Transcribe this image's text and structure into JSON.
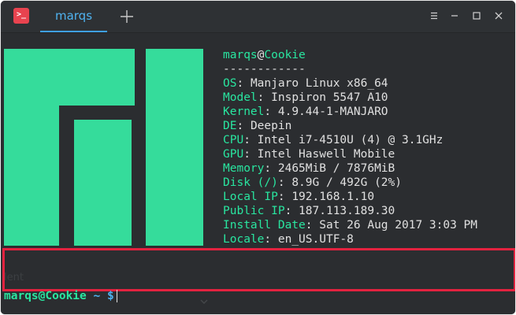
{
  "titlebar": {
    "app_icon_glyph": ">_",
    "tab_label": "marqs"
  },
  "sysinfo": {
    "user": "marqs",
    "at": "@",
    "host": "Cookie",
    "separator": "------------",
    "fields": [
      {
        "key": "OS",
        "value": "Manjaro Linux x86_64"
      },
      {
        "key": "Model",
        "value": "Inspiron 5547 A10"
      },
      {
        "key": "Kernel",
        "value": "4.9.44-1-MANJARO"
      },
      {
        "key": "DE",
        "value": "Deepin"
      },
      {
        "key": "CPU",
        "value": "Intel i7-4510U (4) @ 3.1GHz"
      },
      {
        "key": "GPU",
        "value": "Intel Haswell Mobile"
      },
      {
        "key": "Memory",
        "value": "2465MiB / 7876MiB"
      },
      {
        "key": "Disk (/)",
        "value": "8.9G / 492G (2%)"
      },
      {
        "key": "Local IP",
        "value": "192.168.1.10"
      },
      {
        "key": "Public IP",
        "value": "187.113.189.30"
      },
      {
        "key": "Install Date",
        "value": "Sat 26 Aug 2017 3:03 PM"
      },
      {
        "key": "Locale",
        "value": "en_US.UTF-8"
      }
    ]
  },
  "ghost_text": "lent",
  "prompt": {
    "user_host": "marqs@Cookie",
    "path": "~",
    "symbol": "$"
  },
  "colors": {
    "accent_green": "#29e6a0",
    "logo_green": "#35dc9b",
    "tab_blue": "#4fb3f0",
    "highlight_red": "#e3223f",
    "background": "#2b2d30"
  },
  "icons": {
    "app": "terminal-app-icon",
    "add_tab": "plus-icon",
    "menu": "hamburger-menu-icon",
    "minimize": "minimize-icon",
    "maximize": "maximize-icon",
    "close": "close-icon"
  }
}
